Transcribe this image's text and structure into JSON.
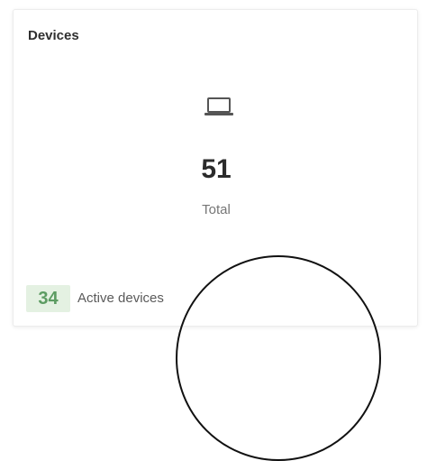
{
  "card": {
    "title": "Devices",
    "icon": "laptop-icon",
    "total_value": "51",
    "total_label": "Total",
    "active_count": "34",
    "active_label": "Active devices"
  },
  "colors": {
    "active_badge_bg": "#e4f1e2",
    "active_badge_text": "#5c9c62",
    "icon_color": "#555555"
  },
  "overlay": {
    "shape": "circle",
    "color": "#111111"
  }
}
